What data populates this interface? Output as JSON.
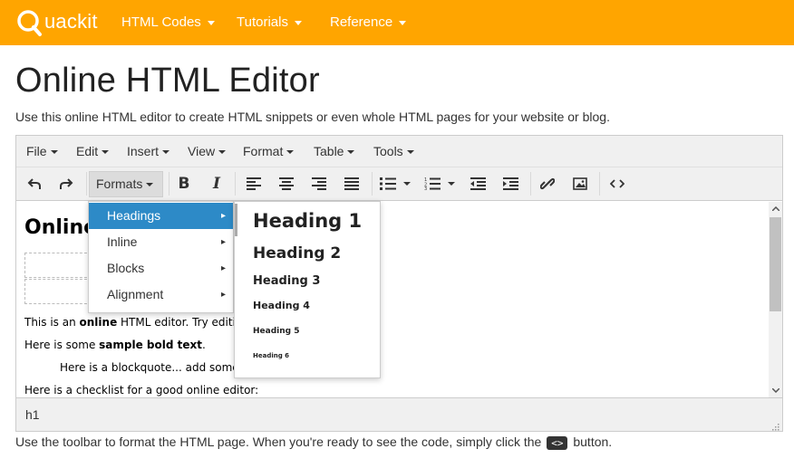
{
  "nav": {
    "logo_text": "uackit",
    "items": [
      {
        "label": "HTML Codes"
      },
      {
        "label": "Tutorials"
      },
      {
        "label": "Reference"
      }
    ]
  },
  "page": {
    "title": "Online HTML Editor",
    "intro": "Use this online HTML editor to create HTML snippets or even whole HTML pages for your website or blog."
  },
  "editor": {
    "menubar": [
      "File",
      "Edit",
      "Insert",
      "View",
      "Format",
      "Table",
      "Tools"
    ],
    "toolbar": {
      "formats_label": "Formats"
    },
    "content": {
      "heading": "Online",
      "line1_pre": "This is an ",
      "line1_bold": "online",
      "line1_post": " HTML editor. Try editing",
      "line2_pre": "Here is some ",
      "line2_bold": "sample bold text",
      "line2_post": ".",
      "blockquote": "Here is a blockquote... add some",
      "checklist": "Here is a checklist for a good online editor:"
    },
    "status_path": "h1"
  },
  "formats_menu": {
    "items": [
      {
        "label": "Headings",
        "active": true
      },
      {
        "label": "Inline"
      },
      {
        "label": "Blocks"
      },
      {
        "label": "Alignment"
      }
    ],
    "submenu": [
      "Heading 1",
      "Heading 2",
      "Heading 3",
      "Heading 4",
      "Heading 5",
      "Heading 6"
    ]
  },
  "footer": {
    "text_pre": "Use the toolbar to format the HTML page. When you're ready to see the code, simply click the",
    "code_label": "<>",
    "text_post": "button."
  },
  "colors": {
    "brand": "#ffa500",
    "menu_active": "#2d8ac7"
  }
}
